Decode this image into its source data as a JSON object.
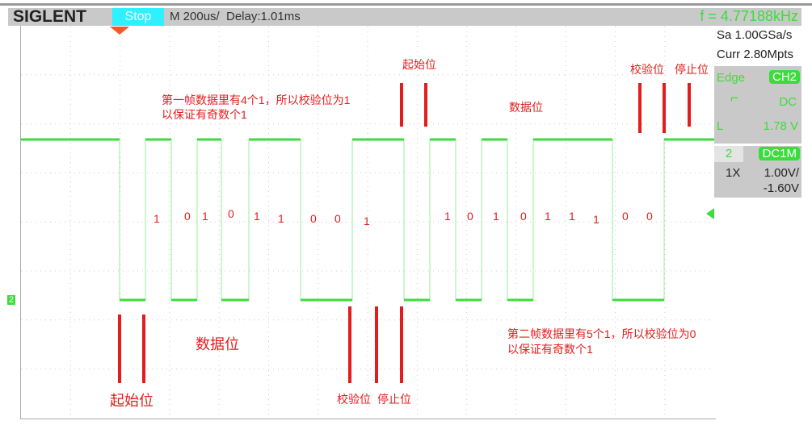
{
  "header": {
    "brand": "SIGLENT",
    "run_state": "Stop",
    "timebase": "M 200us/",
    "delay": "Delay:1.01ms",
    "frequency": "f = 4.77188kHz"
  },
  "side": {
    "sample_rate": "Sa 1.00GSa/s",
    "memory": "Curr 2.80Mpts",
    "trigger": {
      "type": "Edge",
      "source": "CH2",
      "coupling": "DC",
      "level_label": "L",
      "level": "1.78 V",
      "slope_icon": "falling-edge-icon"
    },
    "channel": {
      "number": "2",
      "coupling": "DC1M",
      "probe": "1X",
      "scale": "1.00V/",
      "offset": "-1.60V"
    }
  },
  "colors": {
    "trace": "#3ddc3d",
    "annotation": "#e41c1c",
    "stop": "#2ef0ff"
  },
  "annotations": {
    "frame1_note_1": "第一帧数据里有4个1，所以校验位为1",
    "frame1_note_2": "以保证有奇数个1",
    "frame1_start": "起始位",
    "frame1_data": "数据位",
    "frame1_parity": "校验位",
    "frame1_stop": "停止位",
    "frame2_start": "起始位",
    "frame2_data": "数据位",
    "frame2_parity": "校验位",
    "frame2_stop": "停止位",
    "frame2_note_1": "第二帧数据里有5个1，所以校验位为0",
    "frame2_note_2": "以保证有奇数个1"
  },
  "bits": {
    "frame1": [
      "1",
      "0",
      "1",
      "0",
      "1",
      "1",
      "0",
      "0",
      "1"
    ],
    "frame2": [
      "1",
      "0",
      "1",
      "0",
      "1",
      "1",
      "1",
      "0",
      "0"
    ]
  },
  "channel_marker": "2"
}
